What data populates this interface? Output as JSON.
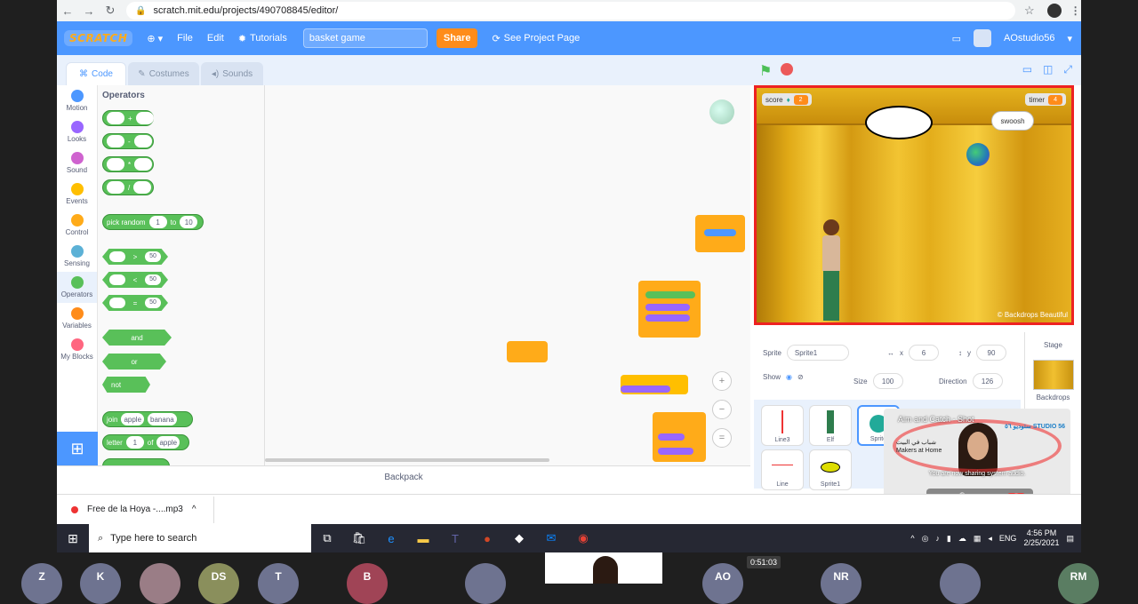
{
  "browser": {
    "url": "scratch.mit.edu/projects/490708845/editor/"
  },
  "menu": {
    "logo": "SCRATCH",
    "file": "File",
    "edit": "Edit",
    "tutorials": "Tutorials",
    "project_title": "basket game",
    "share": "Share",
    "see_project_page": "See Project Page",
    "username": "AOstudio56"
  },
  "tabs": {
    "code": "Code",
    "costumes": "Costumes",
    "sounds": "Sounds"
  },
  "categories": [
    {
      "label": "Motion",
      "color": "#4c97ff"
    },
    {
      "label": "Looks",
      "color": "#9966ff"
    },
    {
      "label": "Sound",
      "color": "#cf63cf"
    },
    {
      "label": "Events",
      "color": "#ffbf00"
    },
    {
      "label": "Control",
      "color": "#ffab19"
    },
    {
      "label": "Sensing",
      "color": "#5cb1d6"
    },
    {
      "label": "Operators",
      "color": "#59c059"
    },
    {
      "label": "Variables",
      "color": "#ff8c1a"
    },
    {
      "label": "My Blocks",
      "color": "#ff6680"
    }
  ],
  "palette": {
    "heading": "Operators",
    "ops": [
      "+",
      "-",
      "*",
      "/"
    ],
    "pick_random": {
      "label": "pick random",
      "from": "1",
      "to_word": "to",
      "to": "10"
    },
    "compare_ops": [
      ">",
      "<",
      "="
    ],
    "compare_value": "50",
    "and": "and",
    "or": "or",
    "not": "not",
    "join": {
      "label": "join",
      "a": "apple",
      "b": "banana"
    },
    "letter": {
      "label": "letter",
      "n": "1",
      "of_word": "of",
      "s": "apple"
    }
  },
  "backpack": "Backpack",
  "stage": {
    "score_label": "score",
    "score_value": "2",
    "timer_label": "timer",
    "timer_value": "4",
    "bubble": "swoosh",
    "credit": "© Backdrops Beautiful"
  },
  "sprite_info": {
    "sprite_label": "Sprite",
    "sprite_name": "Sprite1",
    "x_label": "x",
    "x_value": "6",
    "y_label": "y",
    "y_value": "90",
    "show_label": "Show",
    "size_label": "Size",
    "size_value": "100",
    "direction_label": "Direction",
    "direction_value": "126"
  },
  "stage_pane": {
    "label": "Stage",
    "backdrops": "Backdrops"
  },
  "sprites": [
    "Line3",
    "Elf",
    "Sprite",
    "Line",
    "Sprite1"
  ],
  "video": {
    "title": "Aim and Catch - Shot",
    "makers_ar": "شباب في البيت",
    "makers_en": "Makers at Home",
    "studio": "ستوديو ٥٦ STUDIO 56",
    "notice": "You are now sharing system audio."
  },
  "download": {
    "file": "Free de la Hoya -....mp3"
  },
  "taskbar": {
    "search_placeholder": "Type here to search",
    "lang": "ENG",
    "time": "4:56 PM",
    "date": "2/25/2021"
  },
  "meeting": {
    "timer": "0:51:03",
    "participants": [
      "Z",
      "K",
      "",
      "DS",
      "T",
      "B",
      "",
      "AO",
      "NR",
      "",
      "RM"
    ]
  }
}
